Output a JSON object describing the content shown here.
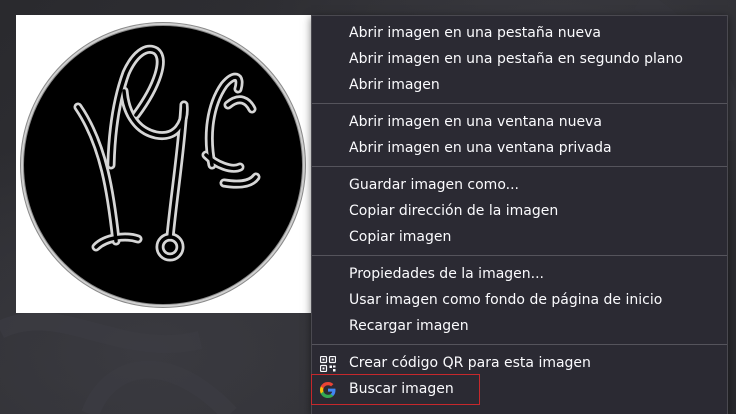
{
  "context_menu": {
    "items": [
      {
        "label": "Abrir imagen en una pestaña nueva",
        "icon": null
      },
      {
        "label": "Abrir imagen en una pestaña en segundo plano",
        "icon": null
      },
      {
        "label": "Abrir imagen",
        "icon": null
      },
      {
        "separator": true
      },
      {
        "label": "Abrir imagen en una ventana nueva",
        "icon": null
      },
      {
        "label": "Abrir imagen en una ventana privada",
        "icon": null
      },
      {
        "separator": true
      },
      {
        "label": "Guardar imagen como...",
        "icon": null
      },
      {
        "label": "Copiar dirección de la imagen",
        "icon": null
      },
      {
        "label": "Copiar imagen",
        "icon": null
      },
      {
        "separator": true
      },
      {
        "label": "Propiedades de la imagen...",
        "icon": null
      },
      {
        "label": "Usar imagen como fondo de página de inicio",
        "icon": null
      },
      {
        "label": "Recargar imagen",
        "icon": null
      },
      {
        "separator": true
      },
      {
        "label": "Crear código QR para esta imagen",
        "icon": "qr-code-icon"
      },
      {
        "label": "Buscar imagen",
        "icon": "google-icon",
        "highlighted": true
      }
    ]
  },
  "colors": {
    "menu_bg": "#2b2a33",
    "menu_text": "#fbfbfe",
    "highlight_border": "#c6282c",
    "google_blue": "#4285f4",
    "google_red": "#ea4335",
    "google_yellow": "#fbbc05",
    "google_green": "#34a853"
  },
  "image": {
    "description_icon": "monogram-logo"
  }
}
